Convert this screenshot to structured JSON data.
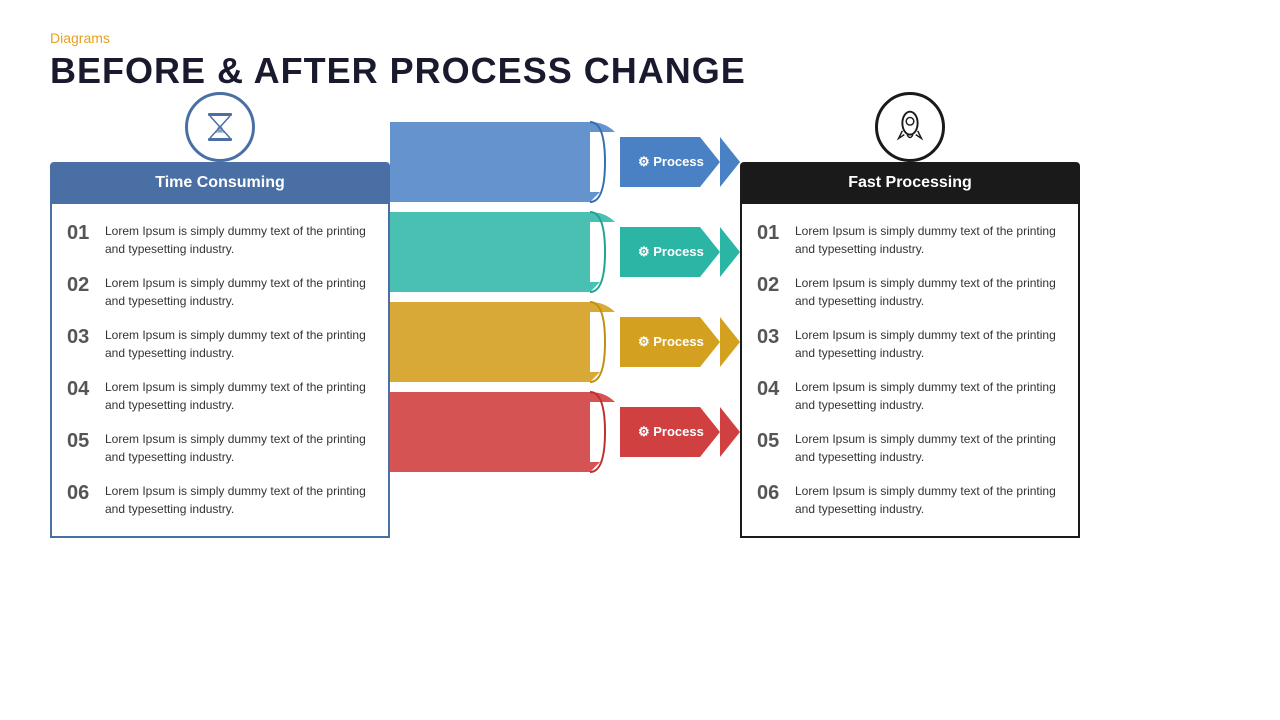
{
  "header": {
    "category": "Diagrams",
    "title": "BEFORE & AFTER PROCESS CHANGE"
  },
  "left_panel": {
    "header": "Time Consuming",
    "icon": "hourglass-icon",
    "items": [
      {
        "number": "01",
        "text": "Lorem Ipsum is simply dummy text of the printing and typesetting industry."
      },
      {
        "number": "02",
        "text": "Lorem Ipsum is simply dummy text of the printing and typesetting industry."
      },
      {
        "number": "03",
        "text": "Lorem Ipsum is simply dummy text of the printing and typesetting industry."
      },
      {
        "number": "04",
        "text": "Lorem Ipsum is simply dummy text of the printing and typesetting industry."
      },
      {
        "number": "05",
        "text": "Lorem Ipsum is simply dummy text of the printing and typesetting industry."
      },
      {
        "number": "06",
        "text": "Lorem Ipsum is simply dummy text of the printing and typesetting industry."
      }
    ]
  },
  "right_panel": {
    "header": "Fast Processing",
    "icon": "rocket-icon",
    "items": [
      {
        "number": "01",
        "text": "Lorem Ipsum is simply dummy text of the printing and typesetting industry."
      },
      {
        "number": "02",
        "text": "Lorem Ipsum is simply dummy text of the printing and typesetting industry."
      },
      {
        "number": "03",
        "text": "Lorem Ipsum is simply dummy text of the printing and typesetting industry."
      },
      {
        "number": "04",
        "text": "Lorem Ipsum is simply dummy text of the printing and typesetting industry."
      },
      {
        "number": "05",
        "text": "Lorem Ipsum is simply dummy text of the printing and typesetting industry."
      },
      {
        "number": "06",
        "text": "Lorem Ipsum is simply dummy text of the printing and typesetting industry."
      }
    ]
  },
  "process_labels": [
    "Process",
    "Process",
    "Process",
    "Process"
  ],
  "colors": {
    "blue": "#4a80c4",
    "teal": "#2ab5a5",
    "yellow": "#d4a020",
    "red": "#d04040",
    "left_header": "#4a6fa5",
    "right_header": "#1a1a1a",
    "orange_accent": "#E8A020"
  }
}
